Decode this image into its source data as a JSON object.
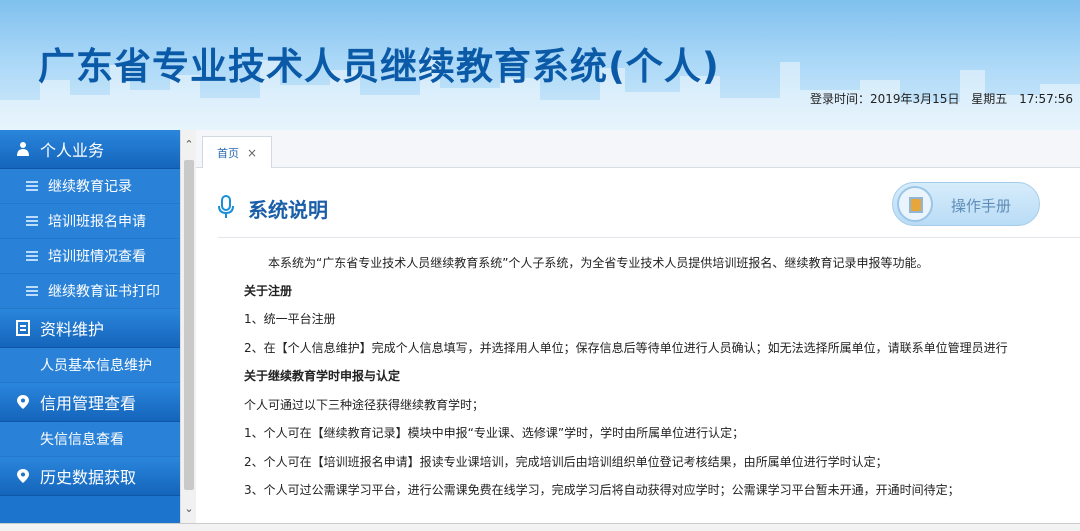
{
  "header": {
    "title": "广东省专业技术人员继续教育系统(个人)",
    "login_label": "登录时间：2019年3月15日",
    "weekday": "星期五",
    "time": "17:57:56"
  },
  "sidebar": {
    "groups": [
      {
        "label": "个人业务",
        "icon": "person-icon",
        "items": [
          "继续教育记录",
          "培训班报名申请",
          "培训班情况查看",
          "继续教育证书打印"
        ]
      },
      {
        "label": "资料维护",
        "icon": "document-icon",
        "items": [
          "人员基本信息维护"
        ]
      },
      {
        "label": "信用管理查看",
        "icon": "location-pin-icon",
        "items": [
          "失信信息查看"
        ]
      },
      {
        "label": "历史数据获取",
        "icon": "location-pin-icon",
        "items": []
      }
    ]
  },
  "tabs": [
    {
      "label": "首页",
      "close": "×"
    }
  ],
  "content": {
    "section_title": "系统说明",
    "manual_button": "操作手册",
    "intro": "本系统为“广东省专业技术人员继续教育系统”个人子系统，为全省专业技术人员提供培训班报名、继续教育记录申报等功能。",
    "register_heading": "关于注册",
    "register_1": "1、统一平台注册",
    "register_2": "2、在【个人信息维护】完成个人信息填写，并选择用人单位；保存信息后等待单位进行人员确认；如无法选择所属单位，请联系单位管理员进行",
    "hours_heading": "关于继续教育学时申报与认定",
    "hours_intro": "个人可通过以下三种途径获得继续教育学时；",
    "hours_1": "1、个人可在【继续教育记录】模块中申报“专业课、选修课”学时，学时由所属单位进行认定；",
    "hours_2": "2、个人可在【培训班报名申请】报读专业课培训，完成培训后由培训组织单位登记考核结果，由所属单位进行学时认定；",
    "hours_3": "3、个人可过公需课学习平台，进行公需课免费在线学习，完成学习后将自动获得对应学时；公需课学习平台暂未开通，开通时间待定；"
  },
  "colors": {
    "sidebar": "#1c74cc",
    "title": "#0b5aa8",
    "section_title": "#1a5ea8"
  }
}
